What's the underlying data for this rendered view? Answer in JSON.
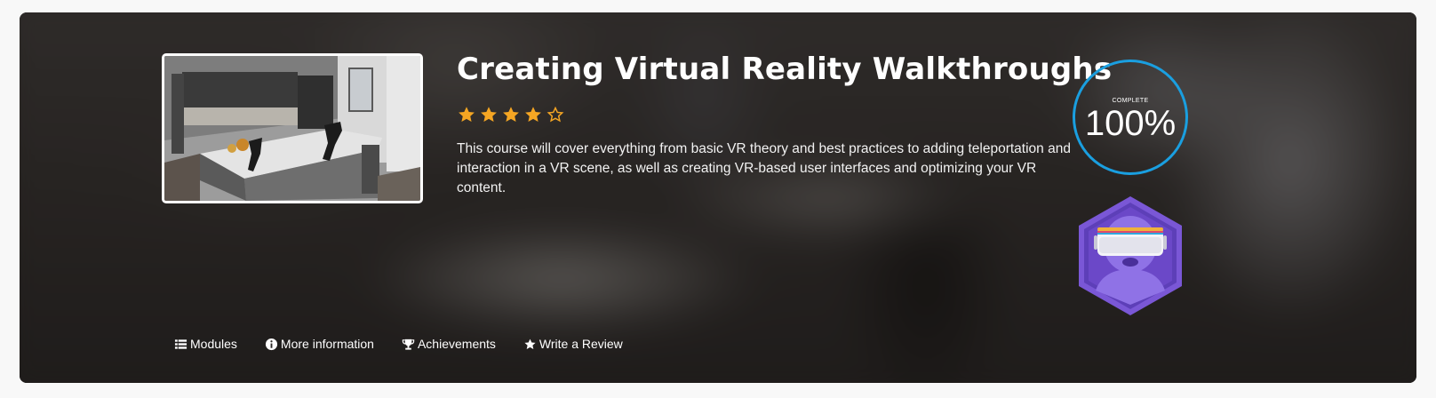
{
  "course": {
    "title": "Creating Virtual Reality Walkthroughs",
    "rating": 4,
    "rating_max": 5,
    "description": "This course will cover everything from basic VR theory and best practices to adding teleportation and interaction in a VR scene, as well as creating VR-based user interfaces and optimizing your VR content."
  },
  "progress": {
    "label": "COMPLETE",
    "value": "100%",
    "fraction": 1.0
  },
  "badge": {
    "icon": "vr-headset-badge-icon"
  },
  "nav": {
    "modules_label": "Modules",
    "more_info_label": "More information",
    "achievements_label": "Achievements",
    "review_label": "Write a Review"
  },
  "colors": {
    "star": "#f5a623",
    "ring": "#1a9fe0",
    "badge_purple": "#6b48c8"
  }
}
